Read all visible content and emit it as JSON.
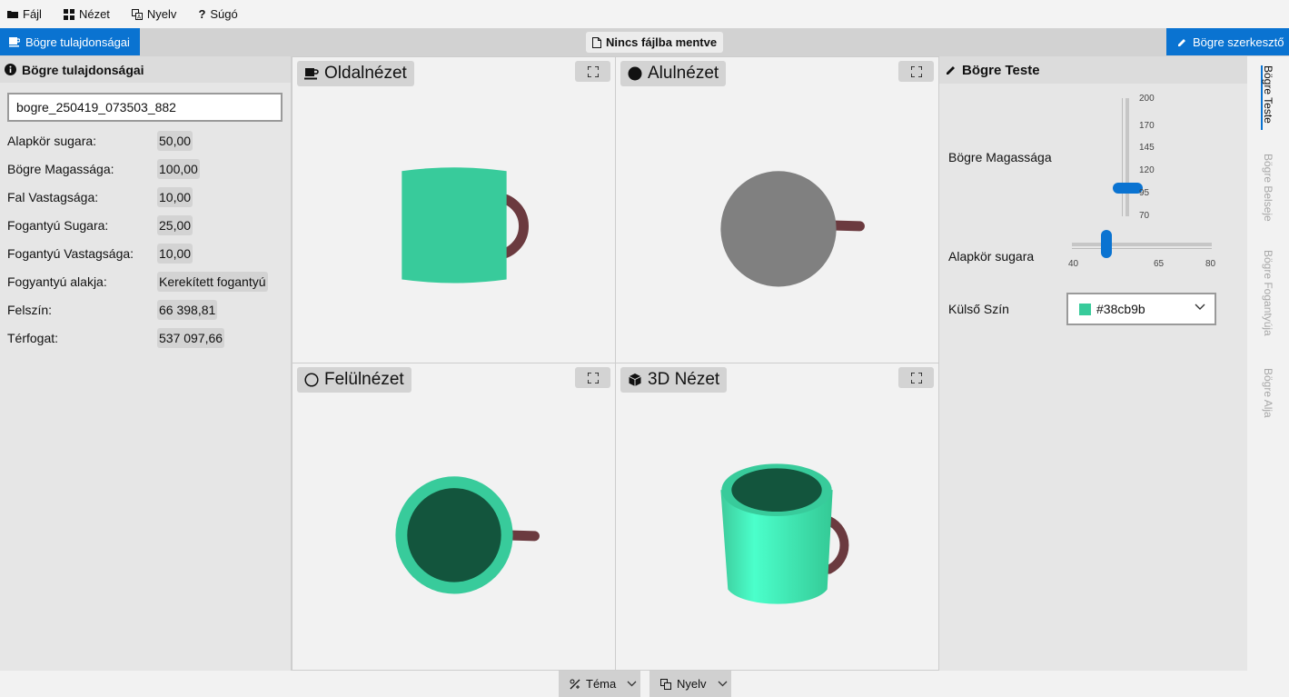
{
  "menu": {
    "file": "Fájl",
    "view": "Nézet",
    "language": "Nyelv",
    "help": "Súgó"
  },
  "tabs": {
    "left": "Bögre tulajdonságai",
    "file_status": "Nincs fájlba mentve",
    "right": "Bögre szerkesztő"
  },
  "properties": {
    "title": "Bögre tulajdonságai",
    "name_value": "bogre_250419_073503_882",
    "rows": [
      {
        "label": "Alapkör sugara:",
        "value": "50,00"
      },
      {
        "label": "Bögre Magassága:",
        "value": "100,00"
      },
      {
        "label": "Fal Vastagsága:",
        "value": "10,00"
      },
      {
        "label": "Fogantyú Sugara:",
        "value": "25,00"
      },
      {
        "label": "Fogantyú Vastagsága:",
        "value": "10,00"
      },
      {
        "label": "Fogyantyú alakja:",
        "value": "Kerekített fogantyú"
      },
      {
        "label": "Felszín:",
        "value": "66 398,81"
      },
      {
        "label": "Térfogat:",
        "value": "537 097,66"
      }
    ]
  },
  "views": {
    "side": "Oldalnézet",
    "bottom": "Alulnézet",
    "top": "Felülnézet",
    "three_d": "3D Nézet"
  },
  "editor": {
    "title": "Bögre Teste",
    "height_label": "Bögre Magassága",
    "height_ticks": [
      "200",
      "170",
      "145",
      "120",
      "95",
      "70"
    ],
    "height_value": 100,
    "height_range": [
      70,
      200
    ],
    "radius_label": "Alapkör sugara",
    "radius_ticks": [
      "40",
      "65",
      "80"
    ],
    "radius_value": 50,
    "radius_range": [
      40,
      80
    ],
    "color_label": "Külső Szín",
    "color_value": "#38cb9b"
  },
  "side_tabs": [
    "Bögre Teste",
    "Bögre Belseje",
    "Bögre Fogantyúja",
    "Bögre Alja"
  ],
  "bottom": {
    "theme": "Téma",
    "language": "Nyelv"
  },
  "colors": {
    "accent": "#0a73d1",
    "mug_outer": "#38cb9b",
    "mug_inner": "#13553d",
    "handle": "#6b3a3f",
    "bottom_gray": "#808080"
  }
}
